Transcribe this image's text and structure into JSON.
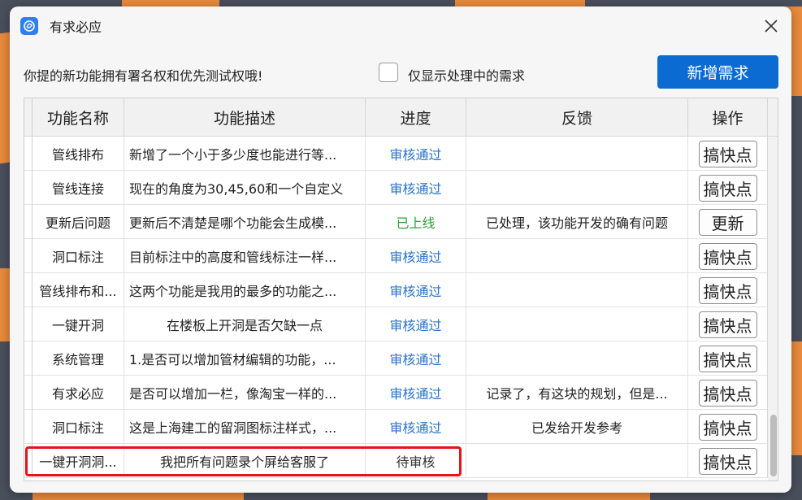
{
  "window": {
    "title": "有求必应",
    "app_icon": "app-logo-icon",
    "close_icon": "close-icon"
  },
  "toolbar": {
    "hint": "你提的新功能拥有署名权和优先测试权哦!",
    "filter_label": "仅显示处理中的需求",
    "filter_checked": false,
    "add_button": "新增需求"
  },
  "table": {
    "headers": [
      "功能名称",
      "功能描述",
      "进度",
      "反馈",
      "操作"
    ],
    "rows": [
      {
        "name": "管线排布",
        "desc": "新增了一个小于多少度也能进行等...",
        "status": "审核通过",
        "status_color": "#2a73c9",
        "feedback": "",
        "action": "搞快点"
      },
      {
        "name": "管线连接",
        "desc": "现在的角度为30,45,60和一个自定义",
        "status": "审核通过",
        "status_color": "#2a73c9",
        "feedback": "",
        "action": "搞快点"
      },
      {
        "name": "更新后问题",
        "desc": "更新后不清楚是哪个功能会生成模...",
        "status": "已上线",
        "status_color": "#2e9e3a",
        "feedback": "已处理，该功能开发的确有问题",
        "action": "更新"
      },
      {
        "name": "洞口标注",
        "desc": "目前标注中的高度和管线标注一样...",
        "status": "审核通过",
        "status_color": "#2a73c9",
        "feedback": "",
        "action": "搞快点"
      },
      {
        "name": "管线排布和...",
        "desc": "这两个功能是我用的最多的功能之...",
        "status": "审核通过",
        "status_color": "#2a73c9",
        "feedback": "",
        "action": "搞快点"
      },
      {
        "name": "一键开洞",
        "desc": "在楼板上开洞是否欠缺一点",
        "status": "审核通过",
        "status_color": "#2a73c9",
        "feedback": "",
        "action": "搞快点"
      },
      {
        "name": "系统管理",
        "desc": "1.是否可以增加管材编辑的功能，...",
        "status": "审核通过",
        "status_color": "#2a73c9",
        "feedback": "",
        "action": "搞快点"
      },
      {
        "name": "有求必应",
        "desc": "是否可以增加一栏，像淘宝一样的...",
        "status": "审核通过",
        "status_color": "#2a73c9",
        "feedback": "记录了，有这块的规划，但是...",
        "action": "搞快点"
      },
      {
        "name": "洞口标注",
        "desc": "这是上海建工的留洞图标注样式，...",
        "status": "审核通过",
        "status_color": "#2a73c9",
        "feedback": "已发给开发参考",
        "action": "搞快点"
      },
      {
        "name": "一键开洞洞...",
        "desc": "我把所有问题录个屏给客服了",
        "status": "待审核",
        "status_color": "#333333",
        "feedback": "",
        "action": "搞快点"
      }
    ]
  },
  "colors": {
    "accent": "#0b6bd3",
    "highlight": "#e4141b"
  }
}
